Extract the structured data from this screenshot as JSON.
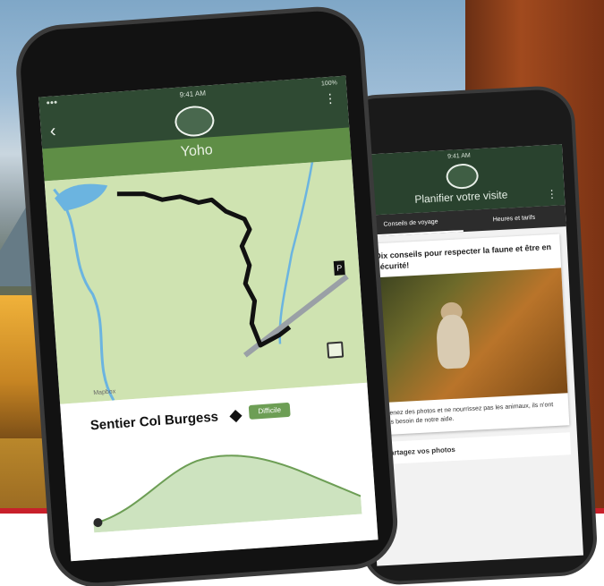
{
  "back_phone": {
    "status": {
      "time": "9:41 AM"
    },
    "title": "Planifier votre visite",
    "tabs": [
      {
        "label": "Conseils de voyage",
        "active": true
      },
      {
        "label": "Heures et tarifs",
        "active": false
      }
    ],
    "card1": {
      "title": "Dix conseils pour respecter la faune et être en sécurité!",
      "text": "Prenez des photos et ne nourrissez pas les animaux, ils n'ont pas besoin de notre aide."
    },
    "card2": {
      "title": "Partagez vos photos"
    },
    "icons": {
      "back": "back-arrow-icon",
      "logo": "parks-canada-logo",
      "more": "more-vertical-icon"
    }
  },
  "front_phone": {
    "status": {
      "time": "9:41 AM",
      "signal": "●●●",
      "battery": "100%"
    },
    "title": "Yoho",
    "map": {
      "credit": "Mapbox",
      "pin_label": "P",
      "route_color": "#111111",
      "water_color": "#6bb4e0",
      "land_color": "#cfe3b1"
    },
    "trail": {
      "name": "Sentier Col Burgess",
      "difficulty_badge": "Difficile"
    },
    "icons": {
      "back": "back-arrow-icon",
      "logo": "parks-canada-logo",
      "more": "more-vertical-icon",
      "fullscreen": "fullscreen-icon",
      "difficulty": "diamond-icon"
    }
  },
  "colors": {
    "header_dark_green": "#2f4a33",
    "title_green": "#5f8e46",
    "badge_green": "#6d9e55",
    "brand_red_bar": "#c8202a"
  }
}
